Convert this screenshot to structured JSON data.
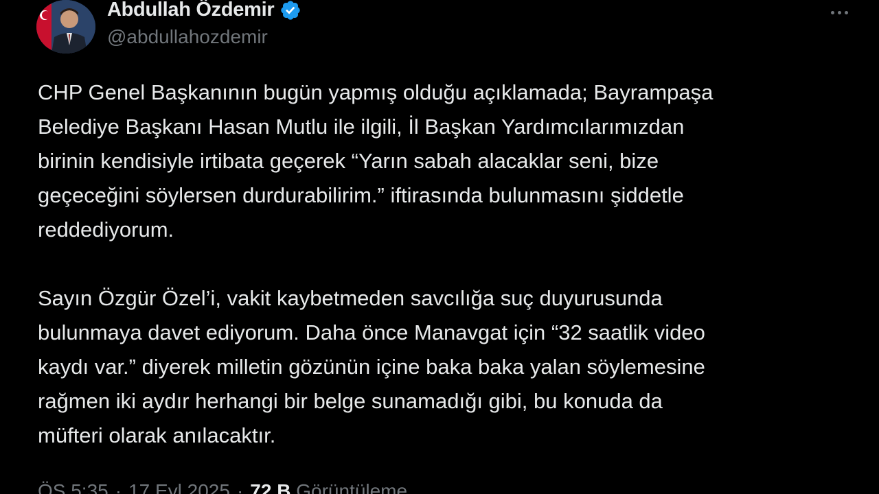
{
  "author": {
    "display_name": "Abdullah Özdemir",
    "handle": "@abdullahozdemir",
    "verified": true,
    "verified_color": "#1d9bf0",
    "avatar_icon": "profile-photo"
  },
  "menu": {
    "icon": "more-horizontal-icon"
  },
  "tweet": {
    "paragraph1_lines": [
      "CHP Genel Başkanının bugün yapmış olduğu açıklamada; Bayrampaşa",
      "Belediye Başkanı Hasan Mutlu ile ilgili, İl Başkan Yardımcılarımızdan",
      "birinin kendisiyle irtibata geçerek “Yarın sabah alacaklar seni, bize",
      "geçeceğini söylersen durdurabilirim.” iftirasında bulunmasını şiddetle",
      "reddediyorum."
    ],
    "paragraph2_lines": [
      "Sayın Özgür Özel’i, vakit kaybetmeden savcılığa suç duyurusunda",
      "bulunmaya davet ediyorum. Daha önce Manavgat için “32 saatlik video",
      "kaydı var.” diyerek milletin gözünün içine baka baka yalan söylemesine",
      "rağmen iki aydır herhangi bir belge sunamadığı gibi, bu konuda da",
      "müfteri olarak anılacaktır."
    ]
  },
  "meta": {
    "time": "ÖS 5:35",
    "separator": "·",
    "date": "17 Eyl 2025",
    "views_count": "72 B",
    "views_label": "Görüntüleme"
  },
  "colors": {
    "background": "#000000",
    "text_primary": "#e7e9ea",
    "text_secondary": "#71767b"
  }
}
